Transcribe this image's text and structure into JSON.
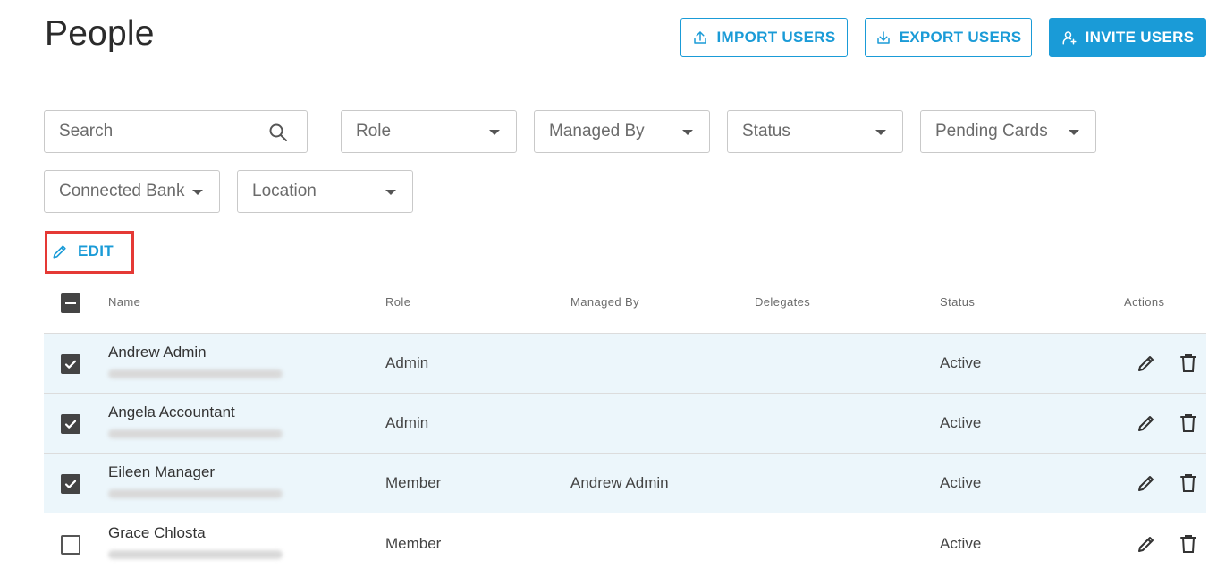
{
  "page": {
    "title": "People"
  },
  "actions": {
    "import_label": "IMPORT USERS",
    "export_label": "EXPORT USERS",
    "invite_label": "INVITE USERS",
    "accent_color": "#1a9bd7"
  },
  "filters": {
    "search_placeholder": "Search",
    "role": "Role",
    "managed_by": "Managed By",
    "status": "Status",
    "pending_cards": "Pending Cards",
    "connected_bank": "Connected Bank",
    "location": "Location"
  },
  "bulk": {
    "edit_label": "EDIT"
  },
  "table": {
    "columns": [
      "Name",
      "Role",
      "Managed By",
      "Delegates",
      "Status",
      "Actions"
    ],
    "rows": [
      {
        "name": "Andrew Admin",
        "role": "Admin",
        "managed_by": "",
        "delegates": "",
        "status": "Active",
        "selected": true
      },
      {
        "name": "Angela Accountant",
        "role": "Admin",
        "managed_by": "",
        "delegates": "",
        "status": "Active",
        "selected": true
      },
      {
        "name": "Eileen Manager",
        "role": "Member",
        "managed_by": "Andrew Admin",
        "delegates": "",
        "status": "Active",
        "selected": true
      },
      {
        "name": "Grace Chlosta",
        "role": "Member",
        "managed_by": "",
        "delegates": "",
        "status": "Active",
        "selected": false
      }
    ]
  }
}
